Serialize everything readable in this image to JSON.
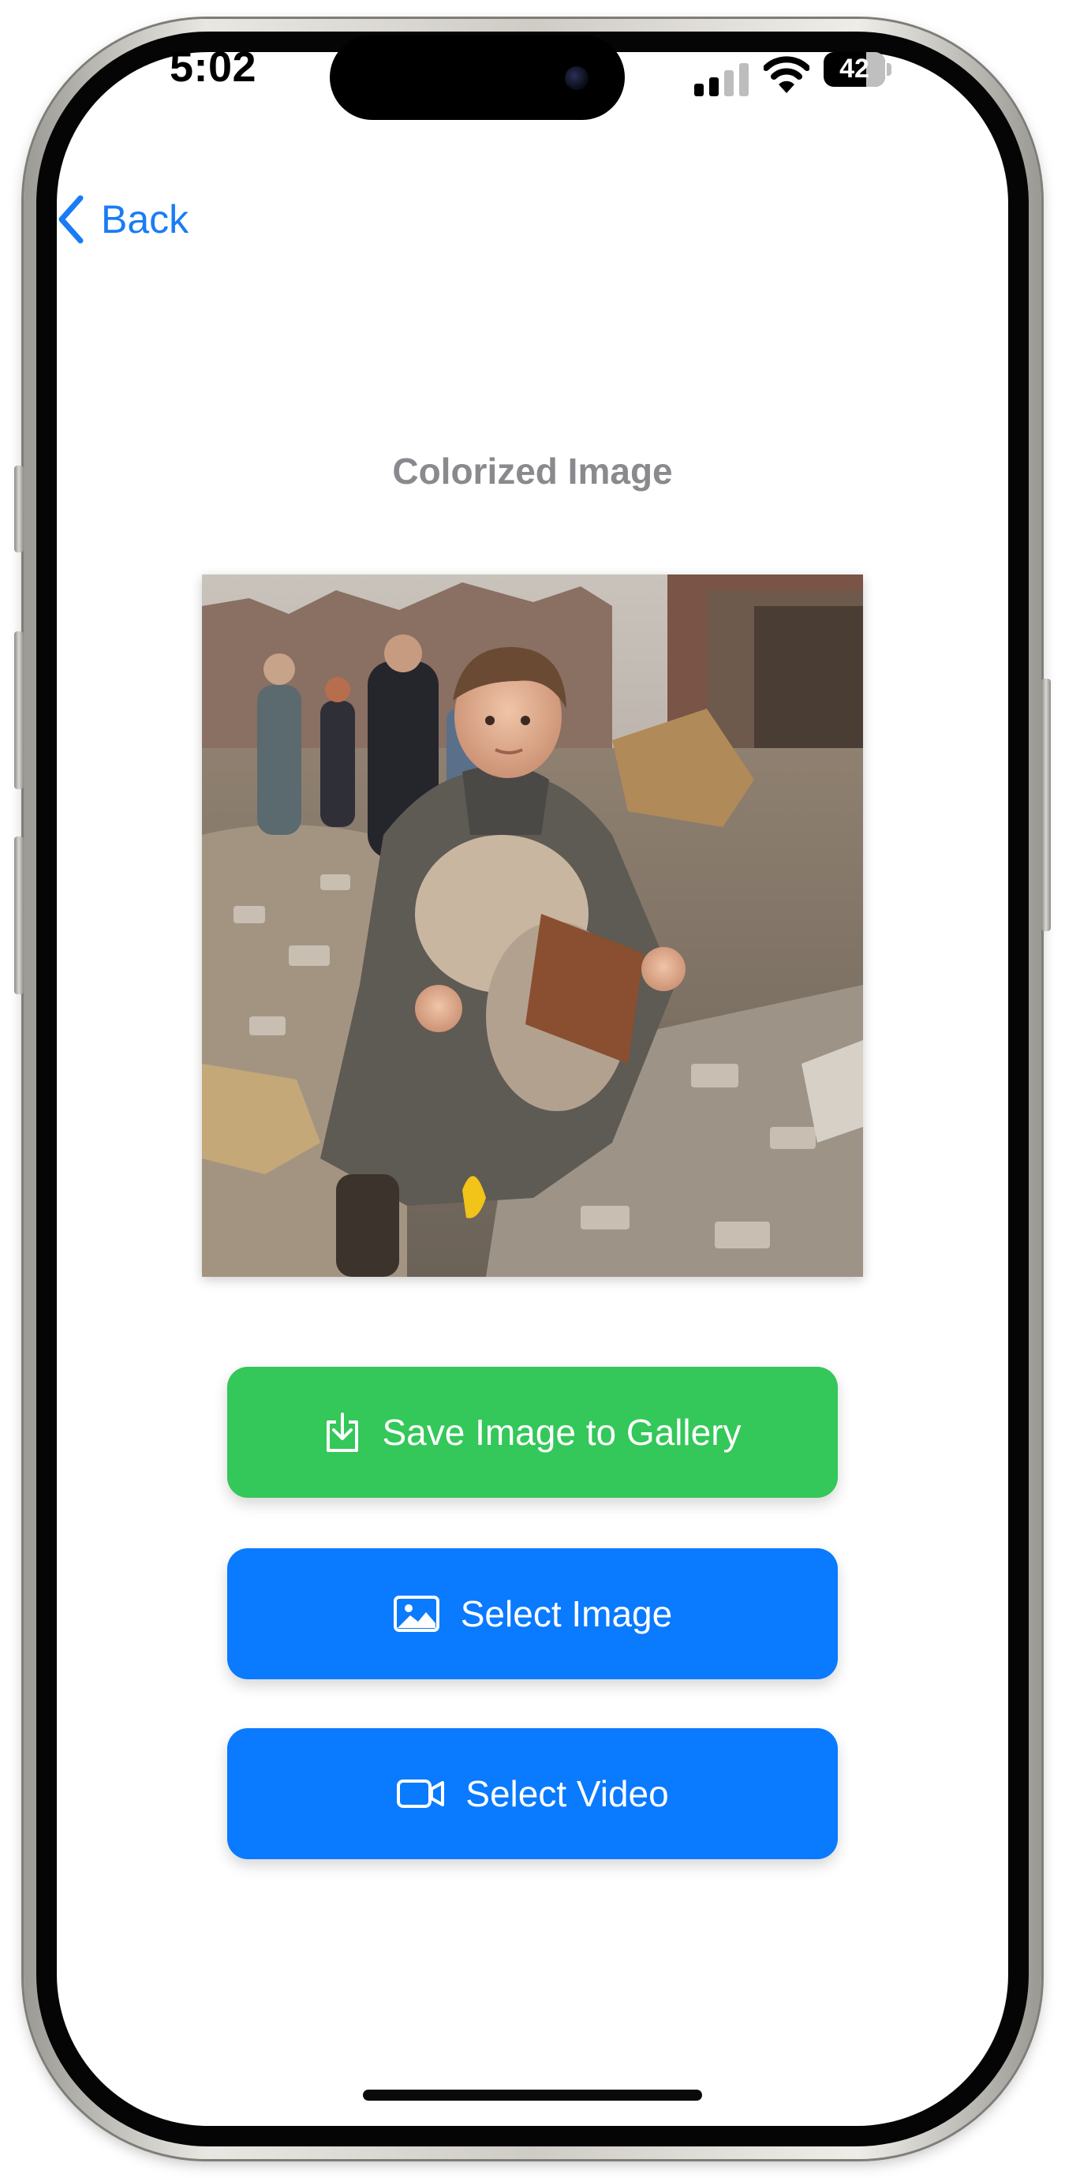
{
  "status_bar": {
    "time": "5:02",
    "battery": "42",
    "icons": [
      "signal-icon",
      "wifi-icon",
      "battery-icon"
    ]
  },
  "nav": {
    "back_label": "Back",
    "back_icon": "chevron-left-icon"
  },
  "main": {
    "title": "Colorized Image",
    "image_alt": "Colorized photograph of a child holding a toy amid rubble",
    "buttons": [
      {
        "label": "Save Image to Gallery",
        "icon": "download-icon"
      },
      {
        "label": "Select Image",
        "icon": "photo-icon"
      },
      {
        "label": "Select Video",
        "icon": "video-camera-icon"
      }
    ]
  },
  "colors": {
    "accent_blue": "#0a7aff",
    "save_green": "#34c759",
    "title_gray": "#8a8a8e"
  }
}
